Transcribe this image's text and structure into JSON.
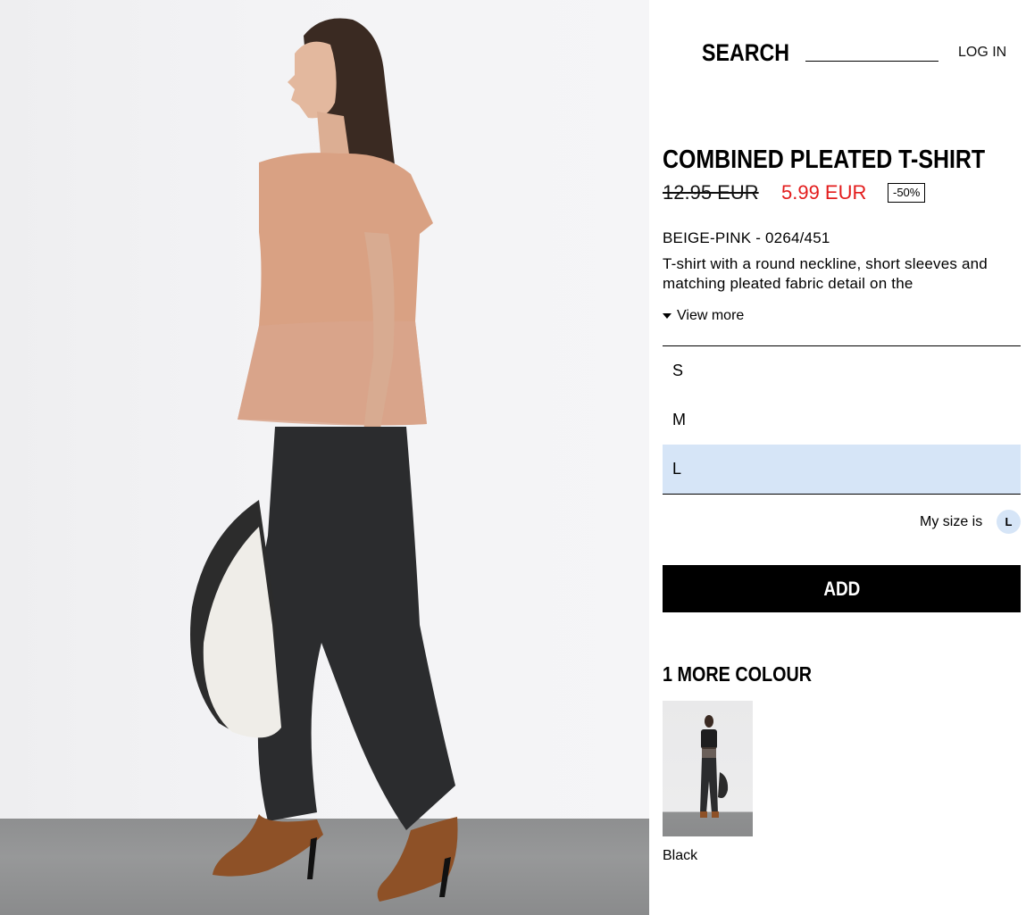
{
  "header": {
    "search_label": "SEARCH",
    "login_label": "LOG IN"
  },
  "product": {
    "title": "COMBINED PLEATED T-SHIRT",
    "old_price": "12.95 EUR",
    "new_price": "5.99 EUR",
    "discount": "-50%",
    "colour_ref": "BEIGE-PINK - 0264/451",
    "description": "T-shirt with a round neckline, short sleeves and matching pleated fabric detail on the",
    "view_more_label": "View more"
  },
  "sizes": {
    "options": [
      "S",
      "M",
      "L"
    ],
    "selected": "L"
  },
  "my_size": {
    "label": "My size is",
    "value": "L"
  },
  "add_label": "ADD",
  "more_colours": {
    "heading": "1 MORE COLOUR",
    "items": [
      {
        "name": "Black"
      }
    ]
  },
  "colors": {
    "sale_price": "#e31c1c",
    "selected_size_bg": "#d6e5f7",
    "add_button_bg": "#000000",
    "tshirt": "#d9a183",
    "pants": "#2b2c2e",
    "boots": "#8e5127"
  }
}
